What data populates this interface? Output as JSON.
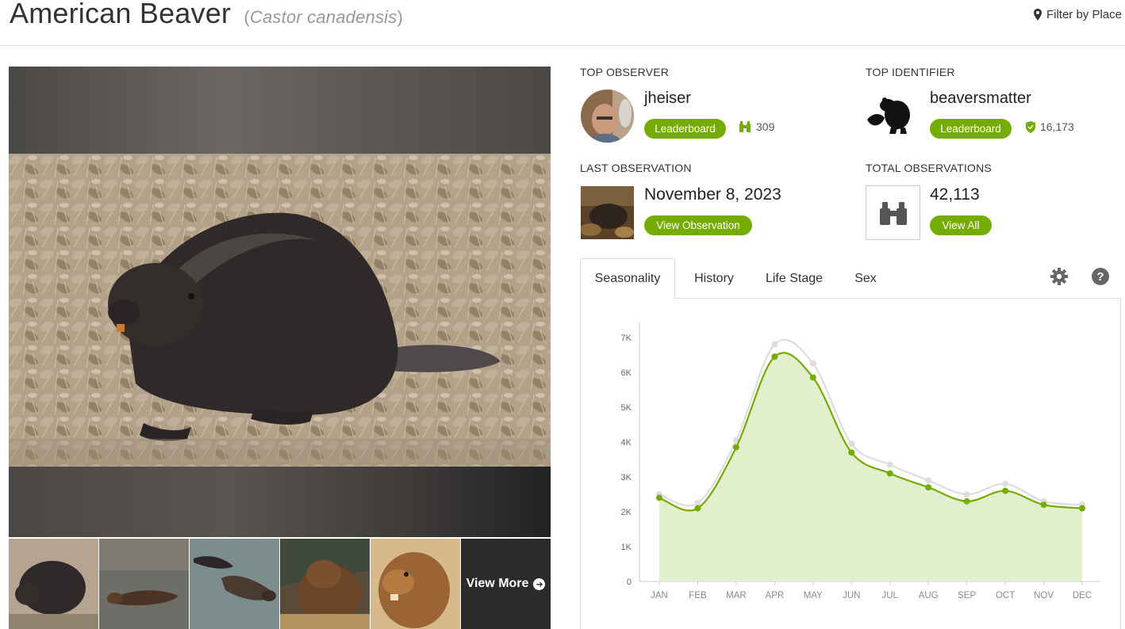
{
  "header": {
    "common_name": "American Beaver",
    "scientific_name": "Castor canadensis",
    "filter_label": "Filter by Place"
  },
  "photos": {
    "view_more_label": "View More"
  },
  "top_observer": {
    "label": "TOP OBSERVER",
    "username": "jheiser",
    "leaderboard_label": "Leaderboard",
    "count": "309"
  },
  "top_identifier": {
    "label": "TOP IDENTIFIER",
    "username": "beaversmatter",
    "leaderboard_label": "Leaderboard",
    "count": "16,173"
  },
  "last_observation": {
    "label": "LAST OBSERVATION",
    "date": "November 8, 2023",
    "button_label": "View Observation"
  },
  "total_observations": {
    "label": "TOTAL OBSERVATIONS",
    "count": "42,113",
    "button_label": "View All"
  },
  "tabs": [
    {
      "label": "Seasonality",
      "active": true
    },
    {
      "label": "History",
      "active": false
    },
    {
      "label": "Life Stage",
      "active": false
    },
    {
      "label": "Sex",
      "active": false
    }
  ],
  "icons": {
    "filter": "map-marker-icon",
    "observer_count": "binoculars-icon",
    "identifier_count": "shield-icon",
    "total": "binoculars-icon",
    "settings": "gear-icon",
    "help": "question-circle-icon",
    "view_more": "arrow-circle-right-icon"
  },
  "colors": {
    "accent": "#74ac00",
    "fill": "#e2efcc",
    "grey_series": "#dddddd"
  },
  "chart_data": {
    "type": "line",
    "categories": [
      "JAN",
      "FEB",
      "MAR",
      "APR",
      "MAY",
      "JUN",
      "JUL",
      "AUG",
      "SEP",
      "OCT",
      "NOV",
      "DEC"
    ],
    "yticks": [
      "0",
      "1K",
      "2K",
      "3K",
      "4K",
      "5K",
      "6K",
      "7K"
    ],
    "ylim": [
      0,
      7500
    ],
    "series": [
      {
        "values": [
          2500,
          2250,
          4050,
          6800,
          6250,
          3950,
          3350,
          2900,
          2500,
          2800,
          2300,
          2200
        ],
        "color": "#dddddd"
      },
      {
        "values": [
          2400,
          2100,
          3850,
          6450,
          5850,
          3700,
          3100,
          2700,
          2300,
          2600,
          2200,
          2100
        ],
        "color": "#74ac00",
        "fill": "#e2efcc"
      }
    ]
  }
}
